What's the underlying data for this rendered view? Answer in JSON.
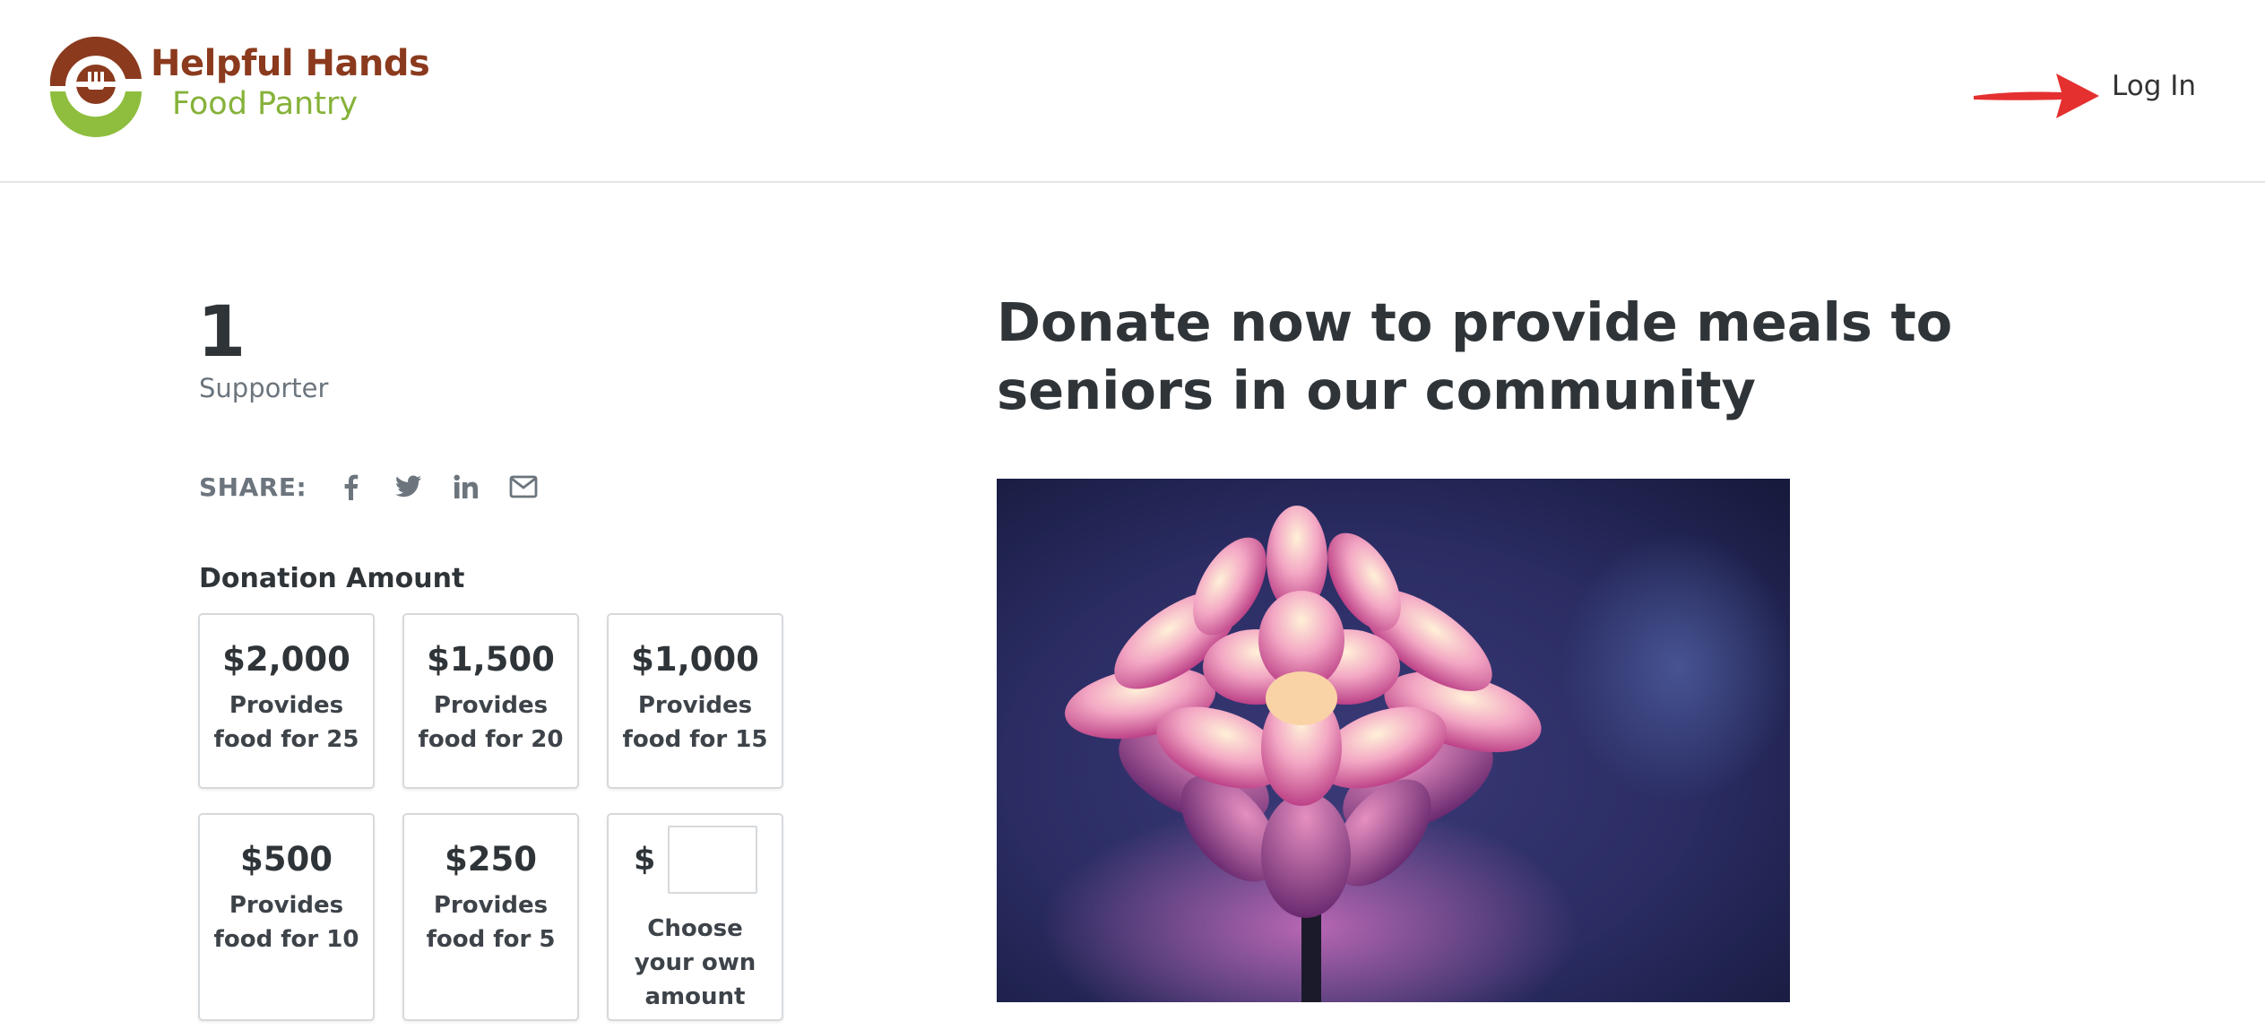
{
  "header": {
    "logo": {
      "line1": "Helpful Hands",
      "line2": "Food Pantry",
      "icon": "fork-plate-icon",
      "colors": {
        "brown": "#8b3a1e",
        "green": "#86b23a"
      }
    },
    "login_label": "Log In",
    "arrow_color": "#e53030"
  },
  "stats": {
    "count": "1",
    "label": "Supporter"
  },
  "share": {
    "label": "SHARE:",
    "icons": [
      "facebook-icon",
      "twitter-icon",
      "linkedin-icon",
      "email-icon"
    ]
  },
  "donation": {
    "label": "Donation Amount",
    "tiles": [
      {
        "amount": "$2,000",
        "desc": "Provides food for 25"
      },
      {
        "amount": "$1,500",
        "desc": "Provides food for 20"
      },
      {
        "amount": "$1,000",
        "desc": "Provides food for 15"
      },
      {
        "amount": "$500",
        "desc": "Provides food for 10"
      },
      {
        "amount": "$250",
        "desc": "Provides food for 5"
      }
    ],
    "custom": {
      "currency": "$",
      "value": "",
      "desc": "Choose your own amount"
    }
  },
  "campaign": {
    "headline": "Donate now to provide meals to seniors in our community",
    "image": "pink-dahlia-flower"
  }
}
